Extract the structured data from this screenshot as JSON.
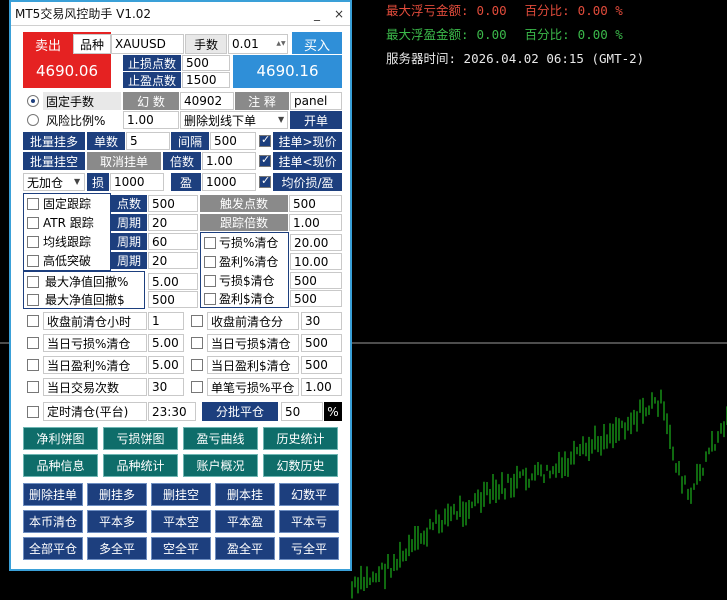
{
  "overlay": {
    "max_loss": {
      "label": "最大浮亏金额:",
      "value": "0.00",
      "pct_label": "百分比:",
      "pct": "0.00 %"
    },
    "max_profit": {
      "label": "最大浮盈金额:",
      "value": "0.00",
      "pct_label": "百分比:",
      "pct": "0.00 %"
    },
    "server_time": "服务器时间: 2026.04.02 06:15 (GMT-2)"
  },
  "colors": {
    "loss": "#e04b3b",
    "profit": "#3bb84a",
    "time": "#e8e8e8",
    "candle": "#1fd41f"
  },
  "title": "MT5交易风控助手 V1.02",
  "titlebar": {
    "minimize": "_",
    "close": "×"
  },
  "sell": {
    "label": "卖出",
    "price": "4690.06"
  },
  "buy": {
    "label": "买入",
    "price": "4690.16"
  },
  "symbol": {
    "label": "品种",
    "value": "XAUUSD"
  },
  "lots": {
    "label": "手数",
    "value": "0.01"
  },
  "sl": {
    "label": "止损点数",
    "value": "500"
  },
  "tp": {
    "label": "止盈点数",
    "value": "1500"
  },
  "mode_fixed": "固定手数",
  "mode_risk": "风险比例%",
  "risk_value": "1.00",
  "magic": {
    "label": "幻 数",
    "value": "40902"
  },
  "comment": {
    "label": "注 释",
    "value": "panel"
  },
  "delete_line": "删除划线下单",
  "open_button": "开单",
  "batch_pending": "批量挂多",
  "batch_pending2": "批量挂空",
  "count": {
    "label": "单数",
    "value": "5"
  },
  "interval": {
    "label": "间隔",
    "value": "500"
  },
  "cancel_pending": "取消挂单",
  "multiple": {
    "label": "倍数",
    "value": "1.00"
  },
  "pending_gt": "挂单>现价",
  "pending_lt": "挂单<现价",
  "add_pos": "无加仓",
  "sl_short": "损",
  "sl_short_val": "1000",
  "tp_short": "盈",
  "tp_short_val": "1000",
  "avg_sl_tp": "均价损/盈",
  "trail": {
    "fixed": "固定跟踪",
    "atr": "ATR 跟踪",
    "ma": "均线跟踪",
    "hilo": "高低突破",
    "points_label": "点数",
    "points": "500",
    "period_label": "周期",
    "period1": "20",
    "period2": "60",
    "period3": "20",
    "trigger_label": "触发点数",
    "trigger": "500",
    "mult_label": "跟踪倍数",
    "mult": "1.00"
  },
  "close_rules": {
    "loss_pct": "亏损%清仓",
    "loss_pct_val": "20.00",
    "profit_pct": "盈利%清仓",
    "profit_pct_val": "10.00",
    "loss_amt": "亏损$清仓",
    "loss_amt_val": "500",
    "profit_amt": "盈利$清仓",
    "profit_amt_val": "500"
  },
  "drawdown": {
    "pct": "最大净值回撤%",
    "pct_val": "5.00",
    "amt": "最大净值回撤$",
    "amt_val": "500"
  },
  "close_before_hours": {
    "label": "收盘前清仓小时",
    "value": "1"
  },
  "close_before_min": {
    "label": "收盘前清仓分",
    "value": "30"
  },
  "day_loss_pct": {
    "label": "当日亏损%清仓",
    "value": "5.00"
  },
  "day_loss_amt": {
    "label": "当日亏损$清仓",
    "value": "500"
  },
  "day_profit_pct": {
    "label": "当日盈利%清仓",
    "value": "5.00"
  },
  "day_profit_amt": {
    "label": "当日盈利$清仓",
    "value": "500"
  },
  "day_trades": {
    "label": "当日交易次数",
    "value": "30"
  },
  "single_loss": {
    "label": "单笔亏损%平仓",
    "value": "1.00"
  },
  "timed_close": {
    "label": "定时清仓(平台)",
    "value": "23:30"
  },
  "partial_close": {
    "label": "分批平仓",
    "value": "50",
    "unit": "%"
  },
  "teal_buttons": [
    "净利饼图",
    "亏损饼图",
    "盈亏曲线",
    "历史统计",
    "品种信息",
    "品种统计",
    "账户概况",
    "幻数历史"
  ],
  "navy_buttons": [
    "删除挂单",
    "删挂多",
    "删挂空",
    "删本挂",
    "幻数平",
    "本币清仓",
    "平本多",
    "平本空",
    "平本盈",
    "平本亏",
    "全部平仓",
    "多全平",
    "空全平",
    "盈全平",
    "亏全平"
  ]
}
